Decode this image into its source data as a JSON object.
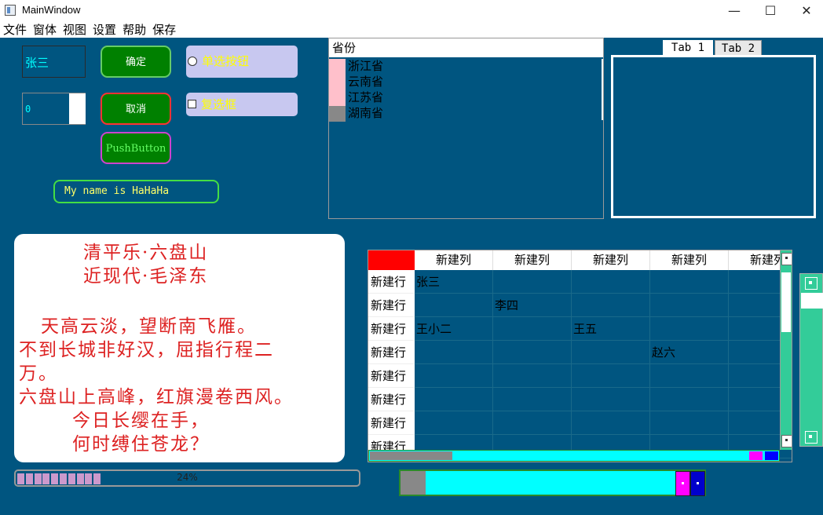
{
  "window": {
    "title": "MainWindow",
    "minimize_glyph": "—",
    "maximize_glyph": "☐",
    "close_glyph": "✕"
  },
  "menu": [
    "文件",
    "窗体",
    "视图",
    "设置",
    "帮助",
    "保存"
  ],
  "form": {
    "line_edit_value": "张三",
    "spin_value": "0",
    "ok_button": "确定",
    "cancel_button": "取消",
    "push_button": "PushButton",
    "radio_label": "单选按钮",
    "checkbox_label": "复选框",
    "name_label": "My name is HaHaHa"
  },
  "list": {
    "header": "省份",
    "items": [
      "浙江省",
      "云南省",
      "江苏省",
      "湖南省"
    ]
  },
  "tabs": [
    "Tab 1",
    "Tab 2"
  ],
  "poem": {
    "title": "清平乐·六盘山",
    "author": "近现代·毛泽东",
    "lines": [
      "天高云淡，望断南飞雁。",
      "不到长城非好汉，屈指行程二",
      "万。",
      "六盘山上高峰，红旗漫卷西风。",
      "今日长缨在手，",
      "何时缚住苍龙？"
    ]
  },
  "progress": {
    "value": 0.24,
    "text": "24%"
  },
  "table": {
    "columns": [
      "新建列",
      "新建列",
      "新建列",
      "新建列",
      "新建列"
    ],
    "row_header": "新建行",
    "rows": [
      [
        "张三",
        "",
        "",
        "",
        ""
      ],
      [
        "",
        "李四",
        "",
        "",
        ""
      ],
      [
        "王小二",
        "",
        "王五",
        "",
        ""
      ],
      [
        "",
        "",
        "",
        "赵六",
        ""
      ],
      [
        "",
        "",
        "",
        "",
        ""
      ],
      [
        "",
        "",
        "",
        "",
        ""
      ],
      [
        "",
        "",
        "",
        "",
        ""
      ],
      [
        "",
        "",
        "",
        "",
        ""
      ]
    ]
  },
  "colors": {
    "background": "#005580",
    "button_green": "#008000",
    "poem_red": "#dd2222",
    "scroll_cyan": "#00ffff",
    "scroll_green": "#33cc99",
    "corner_red": "#ff0000"
  }
}
